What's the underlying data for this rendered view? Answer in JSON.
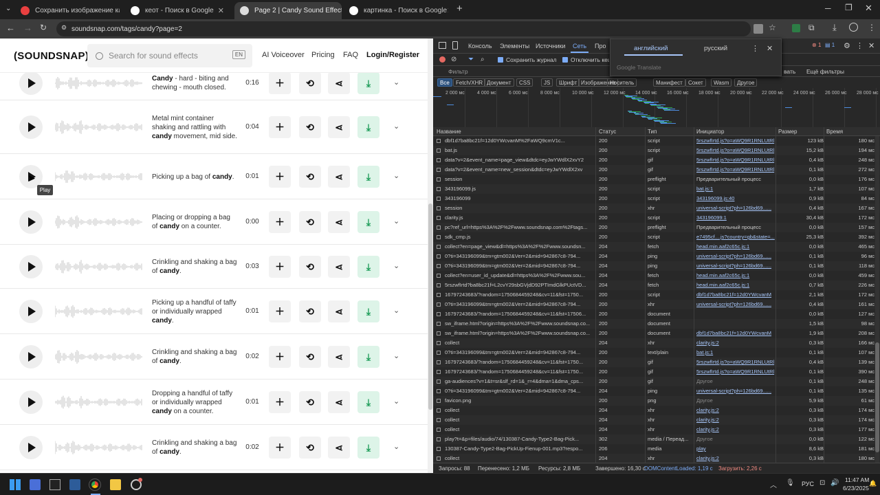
{
  "browser": {
    "tabs": [
      {
        "label": "Сохранить изображение как -",
        "active": false,
        "color": "#e94040"
      },
      {
        "label": "кеот - Поиск в Google",
        "active": false,
        "color": "#ffffff"
      },
      {
        "label": "Page 2 | Candy Sound Effects D",
        "active": true,
        "color": "#dddddd"
      },
      {
        "label": "картинка - Поиск в Google",
        "active": false,
        "color": "#ffffff"
      }
    ],
    "url": "soundsnap.com/tags/candy?page=2"
  },
  "site": {
    "logo": "(SOUNDSNAP)",
    "search_placeholder": "Search for sound effects",
    "lang": "EN",
    "nav": [
      "AI Voiceover",
      "Pricing",
      "FAQ",
      "Login/Register"
    ],
    "tooltip": "Play",
    "rows": [
      {
        "pre": "",
        "kw": "Candy",
        "post": " - hard - biting and chewing - mouth closed.",
        "dur": "0:16"
      },
      {
        "pre": "Metal mint container shaking and rattling with ",
        "kw": "candy",
        "post": " movement, mid side.",
        "dur": "0:04"
      },
      {
        "pre": "Picking up a bag of ",
        "kw": "candy",
        "post": ".",
        "dur": "0:01"
      },
      {
        "pre": "Placing or dropping a bag of ",
        "kw": "candy",
        "post": " on a counter.",
        "dur": "0:00"
      },
      {
        "pre": "Crinkling and shaking a bag of ",
        "kw": "candy",
        "post": ".",
        "dur": "0:03"
      },
      {
        "pre": "Picking up a handful of taffy or individually wrapped ",
        "kw": "candy",
        "post": ".",
        "dur": "0:01"
      },
      {
        "pre": "Crinkling and shaking a bag of ",
        "kw": "candy",
        "post": ".",
        "dur": "0:02"
      },
      {
        "pre": "Dropping a handful of taffy or individually wrapped ",
        "kw": "candy",
        "post": " on a counter.",
        "dur": "0:01"
      },
      {
        "pre": "Crinkling and shaking a bag of ",
        "kw": "candy",
        "post": ".",
        "dur": "0:02"
      }
    ]
  },
  "devtools": {
    "tabs": [
      "Консоль",
      "Элементы",
      "Источники",
      "Сеть",
      "Про"
    ],
    "active_tab": "Сеть",
    "preserve_log": "Сохранить журнал",
    "disable_cache": "Отключить кеш",
    "filter_placeholder": "Фильтр",
    "more_filters": "Ещё фильтры",
    "hide_label": "вать",
    "type_filters": [
      "Все",
      "Fetch/XHR",
      "Документ",
      "CSS",
      "JS",
      "Шрифт",
      "Изображение",
      "Носитель",
      "Манифест",
      "Сокет",
      "Wasm",
      "Другое"
    ],
    "errors": "1",
    "warnings": "1",
    "timeline_labels": [
      "2 000 мс",
      "4 000 мс",
      "6 000 мс",
      "8 000 мс",
      "10 000 мс",
      "12 000 мс",
      "14 000 мс",
      "16 000 мс",
      "18 000 мс",
      "20 000 мс",
      "22 000 мс",
      "24 000 мс",
      "26 000 мс",
      "28 000 мс"
    ],
    "columns": [
      "Название",
      "Статус",
      "Тип",
      "Инициатор",
      "Размер",
      "Время"
    ],
    "rows": [
      [
        "dbf1d7ba8bc21f=12d0YWcvanM%2FaWQ9cmV1c...",
        "200",
        "script",
        "5rszwfIrtd.js?o=aWQ9R1RNLUtRl",
        "123 kB",
        "180 мс"
      ],
      [
        "bat.js",
        "200",
        "script",
        "5rszwfIrtd.js?o=aWQ9R1RNLUtRl",
        "15,2 kB",
        "194 мс"
      ],
      [
        "data?v=2&event_name=page_view&dtdc=eyJwYWdlX2xvY2",
        "200",
        "gif",
        "5rszwfIrtd.js?o=aWQ9R1RNLUtRl",
        "0,4 kB",
        "248 мс"
      ],
      [
        "data?v=2&event_name=new_session&dtdc=eyJwYWdlX2xv",
        "200",
        "gif",
        "5rszwfIrtd.js?o=aWQ9R1RNLUtRl",
        "0,1 kB",
        "272 мс"
      ],
      [
        "session",
        "200",
        "preflight",
        "Предварительный процесс",
        "0,0 kB",
        "176 мс"
      ],
      [
        "343196099.js",
        "200",
        "script",
        "bat.js:1",
        "1,7 kB",
        "107 мс"
      ],
      [
        "343196099",
        "200",
        "script",
        "343196099.js:40",
        "0,9 kB",
        "84 мс"
      ],
      [
        "session",
        "200",
        "xhr",
        "universal-script?ph=126bd69......",
        "0,4 kB",
        "167 мс"
      ],
      [
        "clarity.js",
        "200",
        "script",
        "343196099:1",
        "30,4 kB",
        "172 мс"
      ],
      [
        "pc?ref_url=https%3A%2F%2Fwww.soundsnap.com%2Ftags...",
        "200",
        "preflight",
        "Предварительный процесс",
        "0,0 kB",
        "157 мс"
      ],
      [
        "sdk_cmp.js",
        "200",
        "script",
        "e7495cf....js?country=gb&state=...",
        "25,3 kB",
        "392 мс"
      ],
      [
        "collect?en=page_view&dl=https%3A%2F%2Fwww.soundsn...",
        "204",
        "fetch",
        "head.min.aaf2c65c.js:1",
        "0,0 kB",
        "465 мс"
      ],
      [
        "0?ti=343196099&tm=gtm002&Ver=2&mid=942867c8-794...",
        "204",
        "ping",
        "universal-script?ph=126bd69......",
        "0,1 kB",
        "96 мс"
      ],
      [
        "0?ti=343196099&tm=gtm002&Ver=2&mid=942867c8-794...",
        "204",
        "ping",
        "universal-script?ph=126bd69......",
        "0,1 kB",
        "118 мс"
      ],
      [
        "collect?en=user_id_update&dl=https%3A%2F%2Fwww.sou...",
        "204",
        "fetch",
        "head.min.aaf2c65c.js:1",
        "0,0 kB",
        "459 мс"
      ],
      [
        "5rszwfIrtd?ba8bc21f=L2cvY29sbGVjdD92PTImdGlkPUctVD...",
        "204",
        "fetch",
        "head.min.aaf2c65c.js:1",
        "0,7 kB",
        "226 мс"
      ],
      [
        "16797243683/?random=1750684459248&cv=11&fst=1750...",
        "200",
        "script",
        "dbf1d7ba8bc21f=12d0YWcvanM",
        "2,1 kB",
        "172 мс"
      ],
      [
        "0?ti=343196099&tm=gtm002&Ver=2&mid=942867c8-794...",
        "200",
        "xhr",
        "universal-script?ph=126bd69......",
        "0,4 kB",
        "161 мс"
      ],
      [
        "16797243683/?random=1750684459248&cv=11&fst=17506...",
        "200",
        "document",
        "",
        "0,0 kB",
        "127 мс"
      ],
      [
        "sw_iframe.html?origin=https%3A%2F%2Fwww.soundsnap.co...",
        "200",
        "document",
        "",
        "1,5 kB",
        "98 мс"
      ],
      [
        "sw_iframe.html?origin=https%3A%2F%2Fwww.soundsnap.co...",
        "200",
        "document",
        "dbf1d7ba8bc21f=12d0YWcvanM",
        "1,9 kB",
        "208 мс"
      ],
      [
        "collect",
        "204",
        "xhr",
        "clarity.js:2",
        "0,3 kB",
        "166 мс"
      ],
      [
        "0?ti=343196099&tm=gtm002&Ver=2&mid=942867c8-794...",
        "200",
        "text/plain",
        "bat.js:1",
        "0,1 kB",
        "107 мс"
      ],
      [
        "16797243683/?random=1750684459248&cv=11&fst=1750...",
        "200",
        "gif",
        "5rszwfIrtd.js?o=aWQ9R1RNLUtRl",
        "0,4 kB",
        "139 мс"
      ],
      [
        "16797243683/?random=1750684459248&cv=11&fst=1750...",
        "200",
        "gif",
        "5rszwfIrtd.js?o=aWQ9R1RNLUtRl",
        "0,1 kB",
        "390 мс"
      ],
      [
        "ga-audiences?v=1&t=sr&slf_rd=1&_r=4&dma=1&dma_cps...",
        "200",
        "gif",
        "Другое",
        "0,1 kB",
        "248 мс"
      ],
      [
        "0?ti=343196099&tm=gtm002&Ver=2&mid=942867c8-794...",
        "204",
        "ping",
        "universal-script?ph=126bd69......",
        "0,1 kB",
        "135 мс"
      ],
      [
        "favicon.png",
        "200",
        "png",
        "Другое",
        "5,9 kB",
        "61 мс"
      ],
      [
        "collect",
        "204",
        "xhr",
        "clarity.js:2",
        "0,3 kB",
        "174 мс"
      ],
      [
        "collect",
        "204",
        "xhr",
        "clarity.js:2",
        "0,3 kB",
        "174 мс"
      ],
      [
        "collect",
        "204",
        "xhr",
        "clarity.js:2",
        "0,3 kB",
        "177 мс"
      ],
      [
        "play?t=&p=files/audio/74/130387-Candy-Type2-Bag-Pick...",
        "302",
        "media / Переад...",
        "Другое",
        "0,0 kB",
        "122 мс"
      ],
      [
        "130387-Candy-Type2-Bag-PickUp-Fienup-001.mp3?respo...",
        "206",
        "media",
        "play",
        "8,6 kB",
        "181 мс"
      ],
      [
        "collect",
        "204",
        "xhr",
        "clarity.js:2",
        "0,3 kB",
        "180 мс"
      ]
    ],
    "status_bar": [
      "Запросы: 88",
      "Перенесено: 1,2 МБ",
      "Ресурсы: 2,8 МБ",
      "Завершено: 16,30 с",
      "DOMContentLoaded: 1,19 с",
      "Загрузить: 2,26 с"
    ]
  },
  "translate": {
    "lang1": "английский",
    "lang2": "русский",
    "brand": "Google Translate"
  },
  "taskbar": {
    "lang": "РУС",
    "time": "11:47 AM",
    "date": "6/23/2025"
  }
}
